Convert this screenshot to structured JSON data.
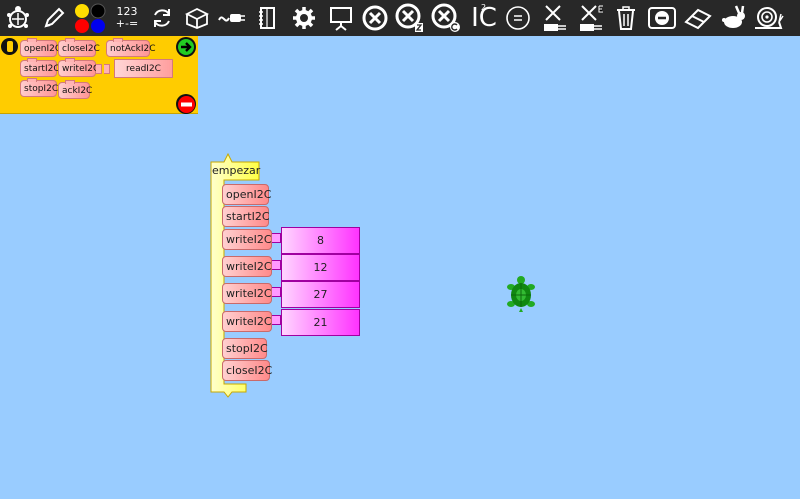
{
  "toolbar": {
    "numbers_label": "123",
    "operators_label": "+-=",
    "i2c_label": "IC",
    "i2c_superscript": "2",
    "i2c_small_label": "2"
  },
  "palette": {
    "blocks": [
      {
        "label": "openI2C"
      },
      {
        "label": "closeI2C"
      },
      {
        "label": "notAckI2C"
      },
      {
        "label": "startI2C"
      },
      {
        "label": "writeI2C"
      },
      {
        "label": "readI2C"
      },
      {
        "label": "stopI2C"
      },
      {
        "label": "ackI2C"
      }
    ]
  },
  "canvas": {
    "start_label": "empezar",
    "blocks": [
      {
        "label": "openI2C"
      },
      {
        "label": "startI2C"
      },
      {
        "label": "writeI2C",
        "value": "8"
      },
      {
        "label": "writeI2C",
        "value": "12"
      },
      {
        "label": "writeI2C",
        "value": "27"
      },
      {
        "label": "writeI2C",
        "value": "21"
      },
      {
        "label": "stopI2C"
      },
      {
        "label": "closeI2C"
      }
    ]
  },
  "colors": {
    "canvas_bg": "#99ccff",
    "toolbar_bg": "#282828",
    "palette_bg": "#ffcc00",
    "block_accent": "#ff8a8a",
    "value_accent": "#ff33ff",
    "start_accent": "#ffff66",
    "turtle": "#22aa22"
  }
}
